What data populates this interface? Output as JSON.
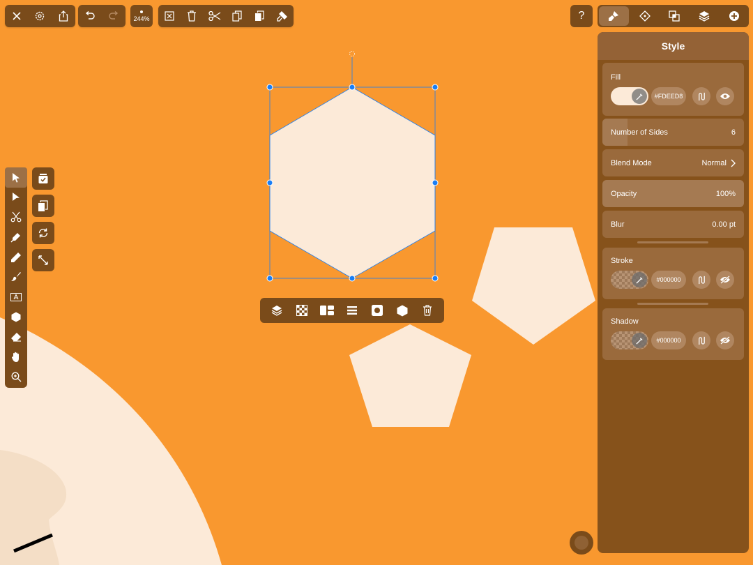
{
  "toolbar": {
    "zoom_label": "244%",
    "help_label": "?"
  },
  "panel": {
    "title": "Style",
    "fill": {
      "label": "Fill",
      "hex": "#FDEED8",
      "color": "#FDEED8"
    },
    "number_of_sides": {
      "label": "Number of Sides",
      "value": "6"
    },
    "blend_mode": {
      "label": "Blend Mode",
      "value": "Normal"
    },
    "opacity": {
      "label": "Opacity",
      "value": "100%"
    },
    "blur": {
      "label": "Blur",
      "value": "0.00 pt"
    },
    "stroke": {
      "label": "Stroke",
      "hex": "#000000"
    },
    "shadow": {
      "label": "Shadow",
      "hex": "#000000"
    }
  },
  "colors": {
    "canvas": "#F9982F",
    "shape_fill": "#FCEAD8",
    "toolbar_bg": "#7A4B1A",
    "panel_bg": "#86521B",
    "selection": "#1A7EF5"
  },
  "left_tools": [
    "select-icon",
    "direct-select-icon",
    "scissors-icon",
    "pen-icon",
    "pencil-icon",
    "brush-icon",
    "text-icon",
    "shape-icon",
    "eraser-icon",
    "hand-icon",
    "zoom-icon"
  ],
  "context_tools": [
    "layers-icon",
    "transparency-icon",
    "arrange-icon",
    "align-icon",
    "mask-icon",
    "shape-icon",
    "delete-icon"
  ]
}
